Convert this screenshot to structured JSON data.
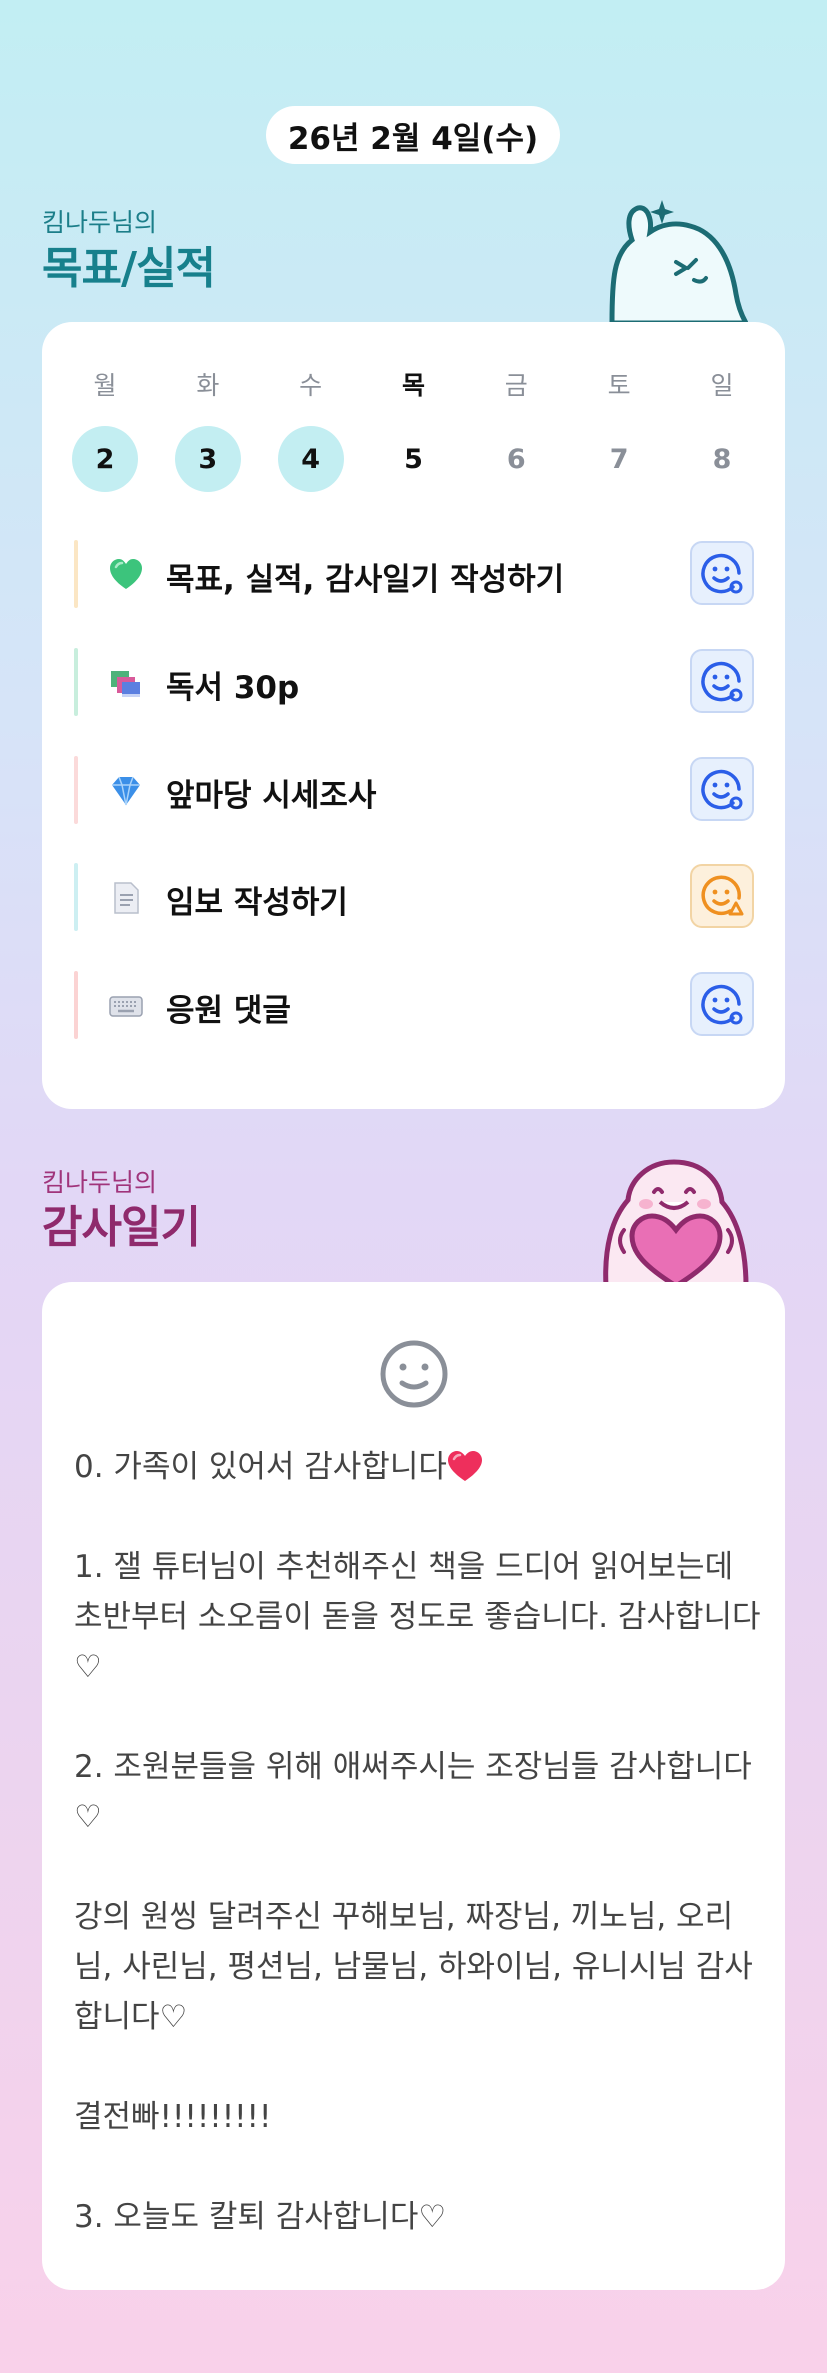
{
  "header": {
    "date": "26년 2월 4일(수)"
  },
  "goals": {
    "owner": "킴나두님의",
    "title": "목표/실적",
    "week": [
      {
        "dow": "월",
        "num": "2",
        "state": "done"
      },
      {
        "dow": "화",
        "num": "3",
        "state": "done"
      },
      {
        "dow": "수",
        "num": "4",
        "state": "done"
      },
      {
        "dow": "목",
        "num": "5",
        "state": "today"
      },
      {
        "dow": "금",
        "num": "6",
        "state": "future"
      },
      {
        "dow": "토",
        "num": "7",
        "state": "future"
      },
      {
        "dow": "일",
        "num": "8",
        "state": "future"
      }
    ],
    "items": [
      {
        "label": "목표, 실적, 감사일기 작성하기",
        "icon": "green-heart-icon",
        "bar_color": "#fbe6c4",
        "status": "blue"
      },
      {
        "label": "독서 30p",
        "icon": "books-icon",
        "bar_color": "#c8eedd",
        "status": "blue"
      },
      {
        "label": "앞마당 시세조사",
        "icon": "gem-icon",
        "bar_color": "#fbdada",
        "status": "blue"
      },
      {
        "label": "임보 작성하기",
        "icon": "page-icon",
        "bar_color": "#cdeff2",
        "status": "orange"
      },
      {
        "label": "응원 댓글",
        "icon": "keyboard-icon",
        "bar_color": "#fbd3d3",
        "status": "blue"
      }
    ],
    "status_colors": {
      "blue": "#2b5ee8",
      "orange": "#ef9020"
    }
  },
  "gratitude": {
    "owner": "킴나두님의",
    "title": "감사일기",
    "mood_icon": "neutral-smile-icon",
    "entries": [
      "0. 가족이 있어서 감사합니다",
      "1. 잴 튜터님이 추천해주신 책을 드디어 읽어보는데 초반부터 소오름이 돋을 정도로 좋습니다. 감사합니다♡",
      "2. 조원분들을 위해 애써주시는 조장님들 감사합니다♡",
      "강의 원씽 달려주신 꾸해보님, 짜장님, 끼노님, 오리님, 사린님, 평션님, 남물님, 하와이님, 유니시님 감사합니다♡",
      "결전빠!!!!!!!!!",
      "3. 오늘도 칼퇴 감사합니다♡"
    ]
  }
}
